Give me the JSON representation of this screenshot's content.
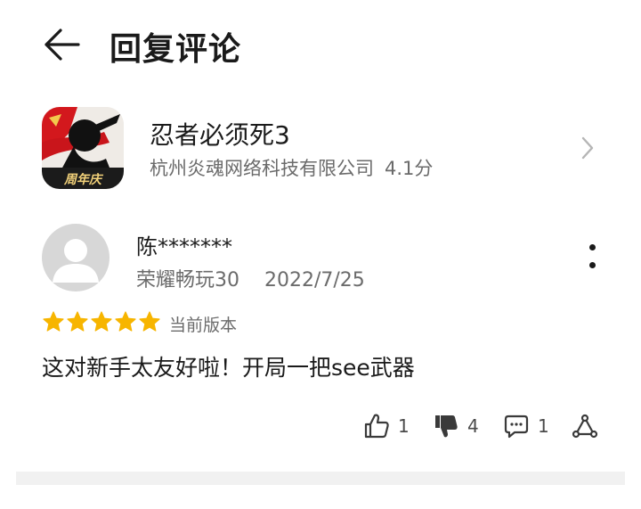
{
  "header": {
    "title": "回复评论",
    "back_icon": "back-arrow-icon"
  },
  "app": {
    "name": "忍者必须死3",
    "developer": "杭州炎魂网络科技有限公司",
    "rating": "4.1分",
    "badge_text": "周年庆",
    "icon": "app-icon",
    "chevron_icon": "chevron-right-icon"
  },
  "review": {
    "reviewer_name": "陈*******",
    "device": "荣耀畅玩30",
    "date": "2022/7/25",
    "stars": 5,
    "star_color": "#f7b500",
    "version_label": "当前版本",
    "text": "这对新手太友好啦！开局一把see武器",
    "more_icon": "more-vertical-icon"
  },
  "actions": {
    "likes": "1",
    "dislikes": "4",
    "comments": "1",
    "like_icon": "thumbs-up-icon",
    "dislike_icon": "thumbs-down-icon",
    "comment_icon": "comment-icon",
    "share_icon": "share-icon"
  }
}
